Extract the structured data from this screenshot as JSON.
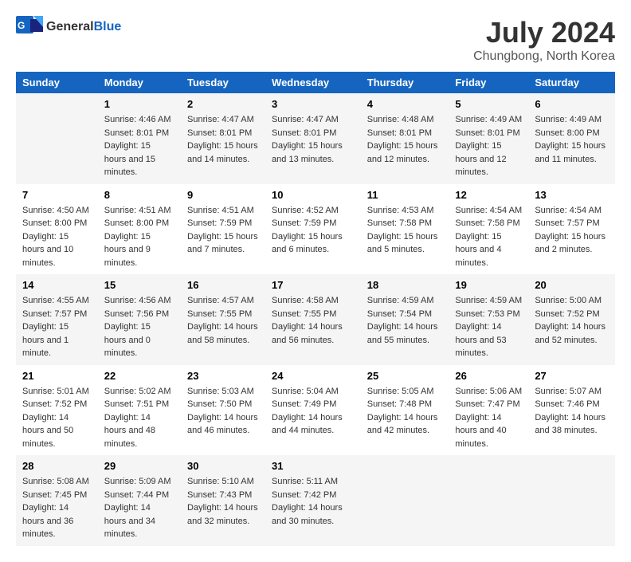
{
  "header": {
    "logo_general": "General",
    "logo_blue": "Blue",
    "month_year": "July 2024",
    "location": "Chungbong, North Korea"
  },
  "days_of_week": [
    "Sunday",
    "Monday",
    "Tuesday",
    "Wednesday",
    "Thursday",
    "Friday",
    "Saturday"
  ],
  "weeks": [
    [
      {
        "day": "",
        "sunrise": "",
        "sunset": "",
        "daylight": ""
      },
      {
        "day": "1",
        "sunrise": "Sunrise: 4:46 AM",
        "sunset": "Sunset: 8:01 PM",
        "daylight": "Daylight: 15 hours and 15 minutes."
      },
      {
        "day": "2",
        "sunrise": "Sunrise: 4:47 AM",
        "sunset": "Sunset: 8:01 PM",
        "daylight": "Daylight: 15 hours and 14 minutes."
      },
      {
        "day": "3",
        "sunrise": "Sunrise: 4:47 AM",
        "sunset": "Sunset: 8:01 PM",
        "daylight": "Daylight: 15 hours and 13 minutes."
      },
      {
        "day": "4",
        "sunrise": "Sunrise: 4:48 AM",
        "sunset": "Sunset: 8:01 PM",
        "daylight": "Daylight: 15 hours and 12 minutes."
      },
      {
        "day": "5",
        "sunrise": "Sunrise: 4:49 AM",
        "sunset": "Sunset: 8:01 PM",
        "daylight": "Daylight: 15 hours and 12 minutes."
      },
      {
        "day": "6",
        "sunrise": "Sunrise: 4:49 AM",
        "sunset": "Sunset: 8:00 PM",
        "daylight": "Daylight: 15 hours and 11 minutes."
      }
    ],
    [
      {
        "day": "7",
        "sunrise": "Sunrise: 4:50 AM",
        "sunset": "Sunset: 8:00 PM",
        "daylight": "Daylight: 15 hours and 10 minutes."
      },
      {
        "day": "8",
        "sunrise": "Sunrise: 4:51 AM",
        "sunset": "Sunset: 8:00 PM",
        "daylight": "Daylight: 15 hours and 9 minutes."
      },
      {
        "day": "9",
        "sunrise": "Sunrise: 4:51 AM",
        "sunset": "Sunset: 7:59 PM",
        "daylight": "Daylight: 15 hours and 7 minutes."
      },
      {
        "day": "10",
        "sunrise": "Sunrise: 4:52 AM",
        "sunset": "Sunset: 7:59 PM",
        "daylight": "Daylight: 15 hours and 6 minutes."
      },
      {
        "day": "11",
        "sunrise": "Sunrise: 4:53 AM",
        "sunset": "Sunset: 7:58 PM",
        "daylight": "Daylight: 15 hours and 5 minutes."
      },
      {
        "day": "12",
        "sunrise": "Sunrise: 4:54 AM",
        "sunset": "Sunset: 7:58 PM",
        "daylight": "Daylight: 15 hours and 4 minutes."
      },
      {
        "day": "13",
        "sunrise": "Sunrise: 4:54 AM",
        "sunset": "Sunset: 7:57 PM",
        "daylight": "Daylight: 15 hours and 2 minutes."
      }
    ],
    [
      {
        "day": "14",
        "sunrise": "Sunrise: 4:55 AM",
        "sunset": "Sunset: 7:57 PM",
        "daylight": "Daylight: 15 hours and 1 minute."
      },
      {
        "day": "15",
        "sunrise": "Sunrise: 4:56 AM",
        "sunset": "Sunset: 7:56 PM",
        "daylight": "Daylight: 15 hours and 0 minutes."
      },
      {
        "day": "16",
        "sunrise": "Sunrise: 4:57 AM",
        "sunset": "Sunset: 7:55 PM",
        "daylight": "Daylight: 14 hours and 58 minutes."
      },
      {
        "day": "17",
        "sunrise": "Sunrise: 4:58 AM",
        "sunset": "Sunset: 7:55 PM",
        "daylight": "Daylight: 14 hours and 56 minutes."
      },
      {
        "day": "18",
        "sunrise": "Sunrise: 4:59 AM",
        "sunset": "Sunset: 7:54 PM",
        "daylight": "Daylight: 14 hours and 55 minutes."
      },
      {
        "day": "19",
        "sunrise": "Sunrise: 4:59 AM",
        "sunset": "Sunset: 7:53 PM",
        "daylight": "Daylight: 14 hours and 53 minutes."
      },
      {
        "day": "20",
        "sunrise": "Sunrise: 5:00 AM",
        "sunset": "Sunset: 7:52 PM",
        "daylight": "Daylight: 14 hours and 52 minutes."
      }
    ],
    [
      {
        "day": "21",
        "sunrise": "Sunrise: 5:01 AM",
        "sunset": "Sunset: 7:52 PM",
        "daylight": "Daylight: 14 hours and 50 minutes."
      },
      {
        "day": "22",
        "sunrise": "Sunrise: 5:02 AM",
        "sunset": "Sunset: 7:51 PM",
        "daylight": "Daylight: 14 hours and 48 minutes."
      },
      {
        "day": "23",
        "sunrise": "Sunrise: 5:03 AM",
        "sunset": "Sunset: 7:50 PM",
        "daylight": "Daylight: 14 hours and 46 minutes."
      },
      {
        "day": "24",
        "sunrise": "Sunrise: 5:04 AM",
        "sunset": "Sunset: 7:49 PM",
        "daylight": "Daylight: 14 hours and 44 minutes."
      },
      {
        "day": "25",
        "sunrise": "Sunrise: 5:05 AM",
        "sunset": "Sunset: 7:48 PM",
        "daylight": "Daylight: 14 hours and 42 minutes."
      },
      {
        "day": "26",
        "sunrise": "Sunrise: 5:06 AM",
        "sunset": "Sunset: 7:47 PM",
        "daylight": "Daylight: 14 hours and 40 minutes."
      },
      {
        "day": "27",
        "sunrise": "Sunrise: 5:07 AM",
        "sunset": "Sunset: 7:46 PM",
        "daylight": "Daylight: 14 hours and 38 minutes."
      }
    ],
    [
      {
        "day": "28",
        "sunrise": "Sunrise: 5:08 AM",
        "sunset": "Sunset: 7:45 PM",
        "daylight": "Daylight: 14 hours and 36 minutes."
      },
      {
        "day": "29",
        "sunrise": "Sunrise: 5:09 AM",
        "sunset": "Sunset: 7:44 PM",
        "daylight": "Daylight: 14 hours and 34 minutes."
      },
      {
        "day": "30",
        "sunrise": "Sunrise: 5:10 AM",
        "sunset": "Sunset: 7:43 PM",
        "daylight": "Daylight: 14 hours and 32 minutes."
      },
      {
        "day": "31",
        "sunrise": "Sunrise: 5:11 AM",
        "sunset": "Sunset: 7:42 PM",
        "daylight": "Daylight: 14 hours and 30 minutes."
      },
      {
        "day": "",
        "sunrise": "",
        "sunset": "",
        "daylight": ""
      },
      {
        "day": "",
        "sunrise": "",
        "sunset": "",
        "daylight": ""
      },
      {
        "day": "",
        "sunrise": "",
        "sunset": "",
        "daylight": ""
      }
    ]
  ]
}
